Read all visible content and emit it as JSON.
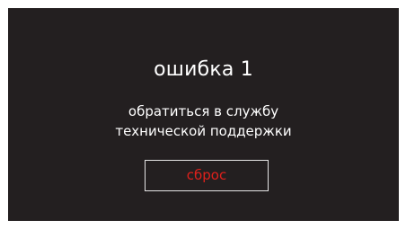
{
  "error": {
    "title": "ошибка 1",
    "message_line1": "обратиться в службу",
    "message_line2": "технической поддержки"
  },
  "actions": {
    "reset_label": "сброс"
  },
  "colors": {
    "background": "#231f20",
    "text": "#ffffff",
    "accent": "#e0201b",
    "border": "#e6e6e6"
  }
}
